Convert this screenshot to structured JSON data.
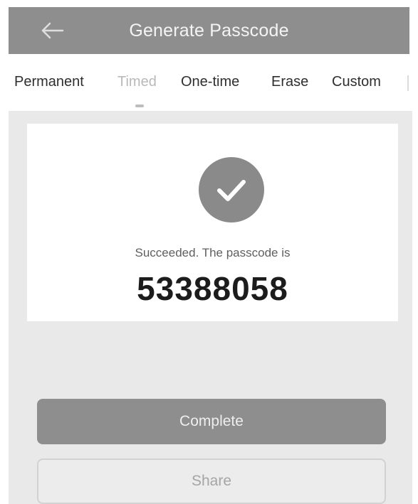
{
  "header": {
    "title": "Generate Passcode",
    "back_icon": "arrow-left-icon",
    "background": "#8e8e8e"
  },
  "tabs": [
    {
      "label": "Permanent",
      "active": false
    },
    {
      "label": "Timed",
      "active": true
    },
    {
      "label": "One-time",
      "active": false
    },
    {
      "label": "Erase",
      "active": false
    },
    {
      "label": "Custom",
      "active": false
    }
  ],
  "result": {
    "icon": "checkmark-circle-icon",
    "message": "Succeeded. The passcode is",
    "passcode": "53388058"
  },
  "buttons": {
    "complete_label": "Complete",
    "share_label": "Share"
  }
}
